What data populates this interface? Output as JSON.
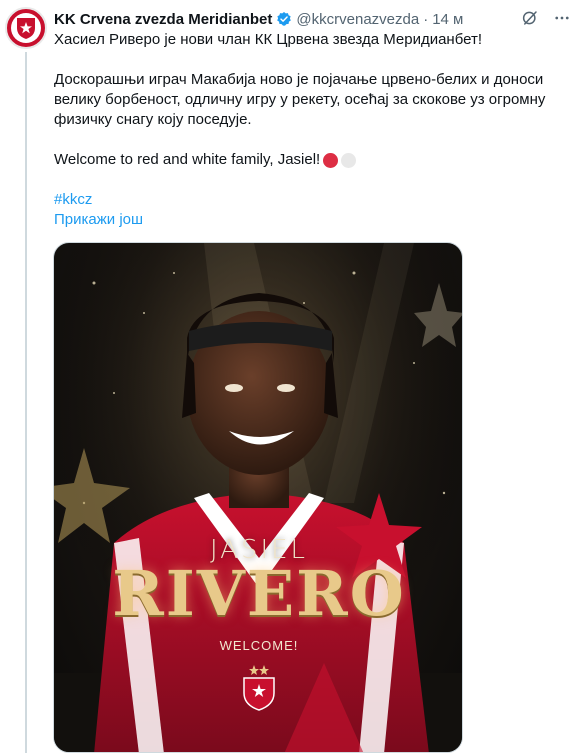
{
  "tweet": {
    "author_name": "KK Crvena zvezda Meridianbet",
    "handle": "@kkcrvenazvezda",
    "separator": "·",
    "time": "14 м",
    "lines": {
      "p1": "Хасиел Риверо је нови члан КК Црвена звезда Меридианбет!",
      "p2": "Доскорашњи играч Макабија ново је појачање црвено-белих и доноси велику борбеност, одличну игру у рекету, осећај за скокове уз огромну физичку снагу коју поседује.",
      "p3": "Welcome to red and white family, Jasiel!"
    },
    "hashtag": "#kkcz",
    "show_more": "Прикажи још",
    "emoji": [
      "red-circle",
      "white-circle"
    ]
  },
  "media": {
    "first_name": "JASIEL",
    "last_name": "RIVERO",
    "welcome": "WELCOME!"
  },
  "colors": {
    "link": "#1d9bf0",
    "secondary": "#536471",
    "brand_red": "#c8102e",
    "gold": "#e8c98a"
  }
}
